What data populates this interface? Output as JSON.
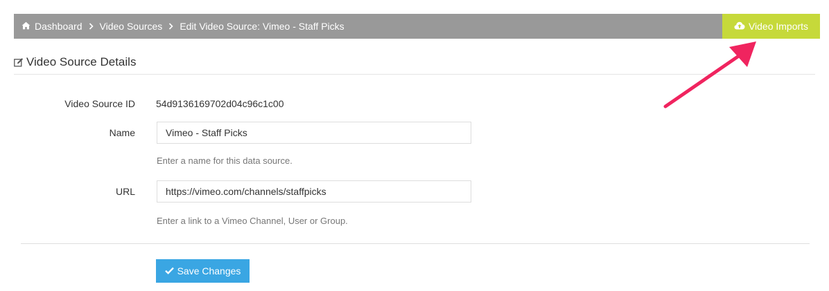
{
  "breadcrumb": {
    "items": [
      {
        "label": "Dashboard"
      },
      {
        "label": "Video Sources"
      },
      {
        "label": "Edit Video Source: Vimeo - Staff Picks"
      }
    ]
  },
  "toolbar": {
    "imports_label": "Video Imports"
  },
  "section": {
    "title": "Video Source Details"
  },
  "form": {
    "id_label": "Video Source ID",
    "id_value": "54d9136169702d04c96c1c00",
    "name_label": "Name",
    "name_value": "Vimeo - Staff Picks",
    "name_help": "Enter a name for this data source.",
    "url_label": "URL",
    "url_value": "https://vimeo.com/channels/staffpicks",
    "url_help": "Enter a link to a Vimeo Channel, User or Group.",
    "save_label": "Save Changes"
  },
  "colors": {
    "topbar": "#999999",
    "imports_button": "#c6d93a",
    "save_button": "#3aa6e3",
    "annotation_arrow": "#f0245f"
  },
  "icons": {
    "home": "home-icon",
    "cloud_upload": "cloud-upload-icon",
    "edit": "edit-icon",
    "check": "check-icon",
    "arrow": "annotation-arrow"
  }
}
